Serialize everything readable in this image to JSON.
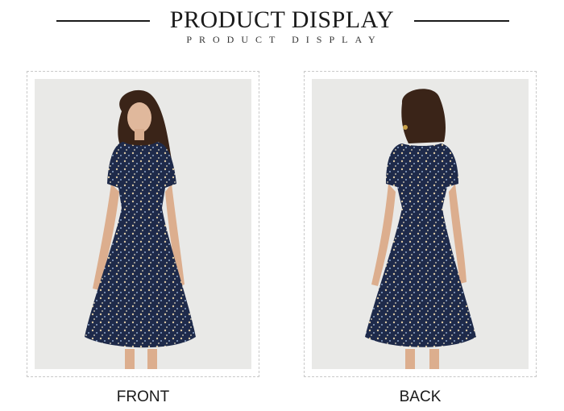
{
  "header": {
    "title": "PRODUCT DISPLAY",
    "subtitle": "PRODUCT DISPLAY"
  },
  "views": [
    {
      "label": "FRONT"
    },
    {
      "label": "BACK"
    }
  ],
  "colors": {
    "dress_navy": "#1e2a4a",
    "backdrop": "#e9e9e7",
    "text": "#1a1a1a"
  }
}
